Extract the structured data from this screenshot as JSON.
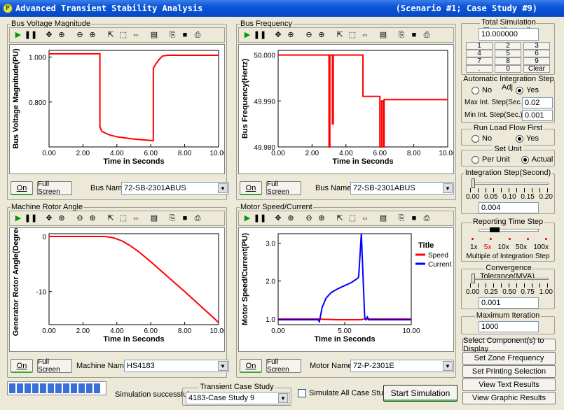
{
  "window": {
    "title": "Advanced Transient Stability Analysis",
    "subtitle": "(Scenario #1; Case Study #9)"
  },
  "panels": {
    "voltage": {
      "title": "Bus Voltage Magnitude",
      "on_label": "On",
      "fullscreen_label": "Full Screen",
      "select_label": "Bus Name :",
      "select_value": "72-SB-2301ABUS"
    },
    "frequency": {
      "title": "Bus Frequency",
      "on_label": "On",
      "fullscreen_label": "Full Screen",
      "select_label": "Bus Name :",
      "select_value": "72-SB-2301ABUS"
    },
    "rotor": {
      "title": "Machine Rotor Angle",
      "on_label": "On",
      "fullscreen_label": "Full Screen",
      "select_label": "Machine Name :",
      "select_value": "HS4183"
    },
    "motor": {
      "title": "Motor Speed/Current",
      "on_label": "On",
      "fullscreen_label": "Full Screen",
      "select_label": "Motor Name :",
      "select_value": "72-P-2301E"
    }
  },
  "chart_data": [
    {
      "type": "line",
      "ylabel": "Bus Voltage Magnitude(PU)",
      "xlabel": "Time in Seconds",
      "xlim": [
        0,
        10
      ],
      "xticks": [
        "0.00",
        "2.00",
        "4.00",
        "6.00",
        "8.00",
        "10.00"
      ],
      "yticks": [
        "1.000",
        "0.800"
      ],
      "ylim": [
        0.6,
        1.03
      ],
      "series": [
        {
          "color": "#ff0000",
          "x": [
            0,
            3.0,
            3.0,
            3.1,
            3.5,
            4.0,
            4.5,
            5.0,
            5.5,
            6.15,
            6.15,
            6.3,
            6.5,
            6.7,
            7.0,
            8.0,
            10.0
          ],
          "y": [
            1.015,
            1.015,
            0.69,
            0.67,
            0.655,
            0.645,
            0.64,
            0.635,
            0.632,
            0.628,
            0.95,
            0.97,
            0.99,
            1.005,
            1.008,
            1.008,
            1.008
          ]
        }
      ]
    },
    {
      "type": "line",
      "ylabel": "Bus Frequency(Hertz)",
      "xlabel": "Time in Seconds",
      "xlim": [
        0,
        10
      ],
      "xticks": [
        "0.00",
        "2.00",
        "4.00",
        "6.00",
        "8.00",
        "10.00"
      ],
      "yticks": [
        "50.000",
        "49.990",
        "49.980"
      ],
      "ylim": [
        49.98,
        50.001
      ],
      "series": [
        {
          "color": "#ff0000",
          "x": [
            0,
            3.0,
            3.0,
            3.05,
            3.05,
            3.2,
            3.2,
            3.25,
            3.25,
            5.0,
            5.0,
            6.0,
            6.0,
            6.1,
            6.1,
            6.2,
            6.2,
            6.25,
            6.25,
            10.0
          ],
          "y": [
            50.0,
            50.0,
            49.98,
            49.98,
            50.0,
            50.0,
            49.985,
            49.985,
            50.0,
            50.0,
            49.991,
            49.991,
            49.98,
            49.98,
            49.99,
            49.99,
            49.98,
            49.98,
            49.9903,
            49.9903
          ]
        }
      ]
    },
    {
      "type": "line",
      "ylabel": "Generator Rotor Angle(Degree)",
      "xlabel": "Time in Seconds",
      "xlim": [
        0,
        10
      ],
      "xticks": [
        "0.00",
        "2.00",
        "4.00",
        "6.00",
        "8.00",
        "10.00"
      ],
      "yticks": [
        "0",
        "-10"
      ],
      "ylim": [
        -16,
        0.5
      ],
      "series": [
        {
          "color": "#ff0000",
          "x": [
            0,
            3.3,
            3.8,
            4.3,
            4.8,
            5.3,
            6.0,
            7.0,
            8.0,
            9.0,
            10.0
          ],
          "y": [
            0,
            0,
            -0.25,
            -0.8,
            -1.7,
            -2.8,
            -4.6,
            -7.3,
            -10.0,
            -12.8,
            -15.6
          ]
        }
      ]
    },
    {
      "type": "line",
      "ylabel": "Motor Speed/Current(PU)",
      "xlabel": "Time in Seconds",
      "xlim": [
        0,
        10
      ],
      "xticks": [
        "0.00",
        "5.00",
        "10.00"
      ],
      "yticks": [
        "3.0",
        "2.0",
        "1.0"
      ],
      "ylim": [
        0.85,
        3.25
      ],
      "legend_title": "Title",
      "series": [
        {
          "name": "Speed",
          "color": "#ff0000",
          "x": [
            0,
            3.0,
            3.5,
            4.5,
            5.5,
            6.2,
            6.5,
            7.0,
            10.0
          ],
          "y": [
            1.0,
            1.0,
            0.99,
            0.98,
            0.98,
            0.98,
            1.0,
            1.0,
            1.0
          ]
        },
        {
          "name": "Current",
          "color": "#0000ff",
          "x": [
            0,
            3.0,
            3.1,
            3.3,
            3.6,
            4.0,
            4.5,
            5.0,
            5.5,
            6.0,
            6.05,
            6.25,
            6.5,
            6.6,
            6.7,
            6.8,
            7.0,
            10.0
          ],
          "y": [
            0.98,
            0.98,
            0.93,
            1.3,
            1.55,
            1.7,
            1.8,
            1.88,
            1.96,
            2.08,
            2.12,
            3.25,
            1.05,
            0.98,
            1.05,
            0.98,
            0.98,
            0.98
          ]
        }
      ]
    }
  ],
  "right_panel": {
    "sim_time": {
      "title": "Total Simulation Time(Second)",
      "value": "10.000000",
      "keys": [
        "1",
        "2",
        "3",
        "4",
        "5",
        "6",
        "7",
        "8",
        "9",
        ".",
        "0",
        "Clear"
      ]
    },
    "auto_step": {
      "title": "Automatic Integration Step Adj",
      "no": "No",
      "yes": "Yes",
      "selected": "Yes",
      "max_label": "Max Int. Step(Sec.) :",
      "max_value": "0.02",
      "min_label": "Min Int. Step(Sec.) :",
      "min_value": "0.001"
    },
    "load_flow": {
      "title": "Run Load Flow First",
      "no": "No",
      "yes": "Yes",
      "selected": "Yes"
    },
    "set_unit": {
      "title": "Set Unit",
      "per_unit": "Per Unit",
      "actual": "Actual",
      "selected": "Actual"
    },
    "int_step": {
      "title": "Integration Step(Second)",
      "ticks": [
        "0.00",
        "0.05",
        "0.10",
        "0.15",
        "0.20"
      ],
      "value": "0.004"
    },
    "report_step": {
      "title": "Reporting Time Step",
      "ticks": [
        "1x",
        "5x",
        "10x",
        "50x",
        "100x"
      ],
      "selected": "5x",
      "caption": "Multiple of Integration Step"
    },
    "convergence": {
      "title": "Convergence Tolerance(MVA)",
      "ticks": [
        "0.00",
        "0.25",
        "0.50",
        "0.75",
        "1.00"
      ],
      "value": "0.001"
    },
    "max_iter": {
      "title": "Maximum Iteration",
      "value": "1000"
    },
    "buttons": [
      "Select Component(s) to Display",
      "Set Zone Frequency",
      "Set Printing Selection",
      "View Text Results",
      "View Graphic Results"
    ]
  },
  "bottom": {
    "status": "Simulation successful",
    "case_title": "Transient Case Study",
    "case_value": "4183-Case Study 9",
    "simulate_all": "Simulate All Case Studies",
    "start": "Start Simulation",
    "progress": 1.0
  },
  "colors": {
    "titlebar": "#0a55d9",
    "speed": "#ff0000",
    "current": "#0000ff",
    "progress": "#3a6fd8"
  }
}
